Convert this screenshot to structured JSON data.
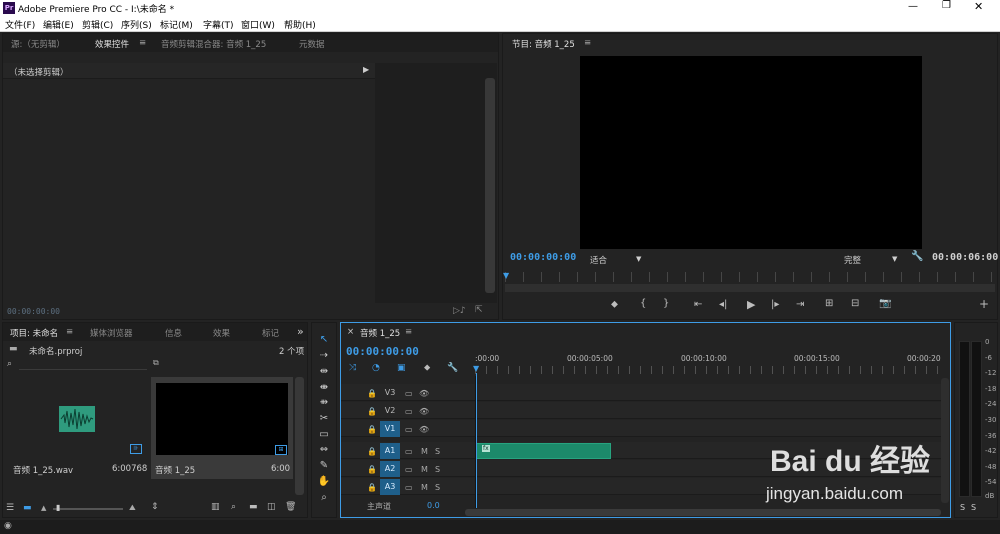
{
  "titlebar": {
    "app_icon": "Pr",
    "title": "Adobe Premiere Pro CC - I:\\未命名 *",
    "minimize": "—",
    "restore": "❐",
    "close": "✕"
  },
  "menus": [
    "文件(F)",
    "编辑(E)",
    "剪辑(C)",
    "序列(S)",
    "标记(M)",
    "字幕(T)",
    "窗口(W)",
    "帮助(H)"
  ],
  "source_panel": {
    "tabs": [
      "源:（无剪辑）",
      "效果控件",
      "音频剪辑混合器: 音频 1_25",
      "元数据"
    ],
    "menu_glyph": "≡",
    "no_clip": "（未选择剪辑）",
    "timecode": "00:00:00:00"
  },
  "program_monitor": {
    "title": "节目: 音频 1_25",
    "menu_glyph": "≡",
    "timecode": "00:00:00:00",
    "fit_value": "适合",
    "quality_value": "完整",
    "duration": "00:00:06:00"
  },
  "project_panel": {
    "tabs": [
      "项目: 未命名",
      "媒体浏览器",
      "信息",
      "效果",
      "标记"
    ],
    "menu_glyph": "≡",
    "more": "»",
    "file_name": "未命名.prproj",
    "item_count": "2 个项",
    "items": [
      {
        "name": "音频 1_25.wav",
        "duration": "6:00768"
      },
      {
        "name": "音频 1_25",
        "duration": "6:00"
      }
    ]
  },
  "timeline": {
    "tab": "音频 1_25",
    "close": "×",
    "menu_glyph": "≡",
    "timecode": "00:00:00:00",
    "ruler": [
      ":00:00",
      "00:00:05:00",
      "00:00:10:00",
      "00:00:15:00",
      "00:00:20"
    ],
    "video_tracks": [
      "V3",
      "V2",
      "V1"
    ],
    "audio_tracks": [
      "A1",
      "A2",
      "A3"
    ],
    "m": "M",
    "s": "S",
    "master": "主声道",
    "master_value": "0.0",
    "clip_label": "fx"
  },
  "meter": {
    "scale": [
      "0",
      "-6",
      "-12",
      "-18",
      "-24",
      "-30",
      "-36",
      "-42",
      "-48",
      "-54",
      "dB"
    ],
    "solo": [
      "S",
      "S"
    ]
  },
  "watermark": {
    "brand": "Bai du 经验",
    "url": "jingyan.baidu.com"
  },
  "colors": {
    "accent": "#3e9ce6",
    "clip": "#1c8a6a",
    "panel": "#232323"
  }
}
